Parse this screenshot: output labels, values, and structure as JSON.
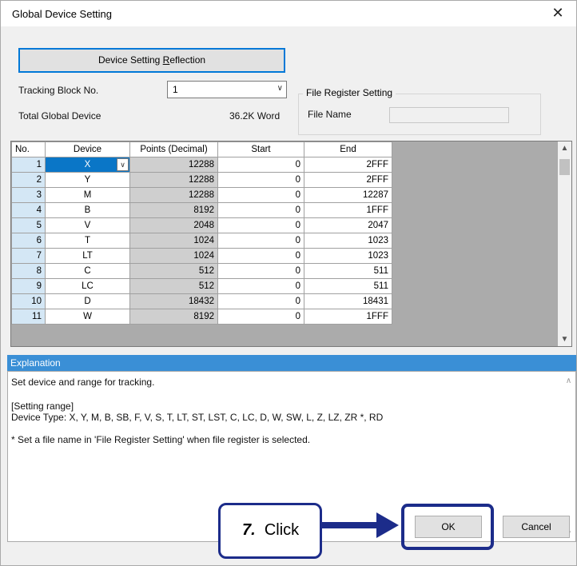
{
  "window": {
    "title": "Global Device Setting",
    "close_glyph": "✕"
  },
  "reflect_button": {
    "label_pre": "Device Setting ",
    "label_key": "R",
    "label_post": "eflection"
  },
  "tracking": {
    "label": "Tracking Block No.",
    "value": "1",
    "arrow": "∨"
  },
  "total": {
    "label": "Total Global Device",
    "value": "36.2K Word"
  },
  "file_register": {
    "group_title": "File Register Setting",
    "file_name_label": "File Name",
    "file_name_value": ""
  },
  "table": {
    "headers": [
      "No.",
      "Device",
      "Points (Decimal)",
      "Start",
      "End"
    ],
    "rows": [
      {
        "no": "1",
        "device": "X",
        "points": "12288",
        "start": "0",
        "end": "2FFF"
      },
      {
        "no": "2",
        "device": "Y",
        "points": "12288",
        "start": "0",
        "end": "2FFF"
      },
      {
        "no": "3",
        "device": "M",
        "points": "12288",
        "start": "0",
        "end": "12287"
      },
      {
        "no": "4",
        "device": "B",
        "points": "8192",
        "start": "0",
        "end": "1FFF"
      },
      {
        "no": "5",
        "device": "V",
        "points": "2048",
        "start": "0",
        "end": "2047"
      },
      {
        "no": "6",
        "device": "T",
        "points": "1024",
        "start": "0",
        "end": "1023"
      },
      {
        "no": "7",
        "device": "LT",
        "points": "1024",
        "start": "0",
        "end": "1023"
      },
      {
        "no": "8",
        "device": "C",
        "points": "512",
        "start": "0",
        "end": "511"
      },
      {
        "no": "9",
        "device": "LC",
        "points": "512",
        "start": "0",
        "end": "511"
      },
      {
        "no": "10",
        "device": "D",
        "points": "18432",
        "start": "0",
        "end": "18431"
      },
      {
        "no": "11",
        "device": "W",
        "points": "8192",
        "start": "0",
        "end": "1FFF"
      }
    ],
    "selected_row": 0,
    "dropdown_glyph": "∨"
  },
  "explanation": {
    "header": "Explanation",
    "line1": "Set device and range for tracking.",
    "line2": "[Setting range]",
    "line3": "Device Type: X, Y, M, B, SB, F, V, S, T, LT, ST, LST, C, LC, D, W, SW, L, Z, LZ, ZR *, RD",
    "line4": "* Set a file name in 'File Register Setting' when file register is selected."
  },
  "buttons": {
    "ok": "OK",
    "cancel": "Cancel"
  },
  "annotation": {
    "step": "7.",
    "action": "Click"
  },
  "colors": {
    "accent": "#0078d7",
    "callout": "#1c2c8a",
    "explanation_header": "#3a8fd6"
  }
}
